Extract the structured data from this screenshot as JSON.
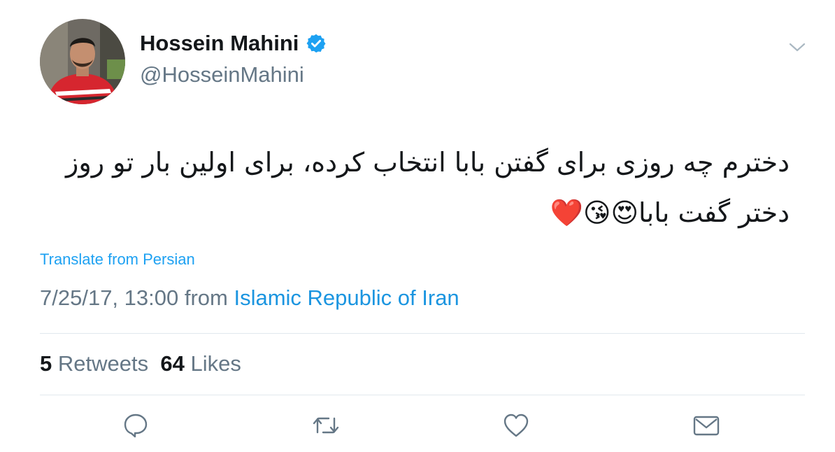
{
  "author": {
    "display_name": "Hossein Mahini",
    "handle": "@HosseinMahini",
    "verified": true
  },
  "tweet": {
    "text_line1": "دخترم چه روزی برای گفتن بابا انتخاب کرده، برای اولین بار تو روز",
    "text_line2": "دختر گفت بابا😍😘❤️",
    "translate_label": "Translate from Persian",
    "timestamp": "7/25/17, 13:00",
    "from_word": "from",
    "location": "Islamic Republic of Iran"
  },
  "stats": {
    "retweets_count": "5",
    "retweets_label": "Retweets",
    "likes_count": "64",
    "likes_label": "Likes"
  },
  "actions": [
    "reply-icon",
    "retweet-icon",
    "like-icon",
    "share-icon"
  ],
  "colors": {
    "accent": "#1da1f2",
    "link": "#1b95e0",
    "secondary_text": "#657786",
    "primary_text": "#14171a",
    "divider": "#e1e8ed",
    "verified": "#1da1f2"
  }
}
